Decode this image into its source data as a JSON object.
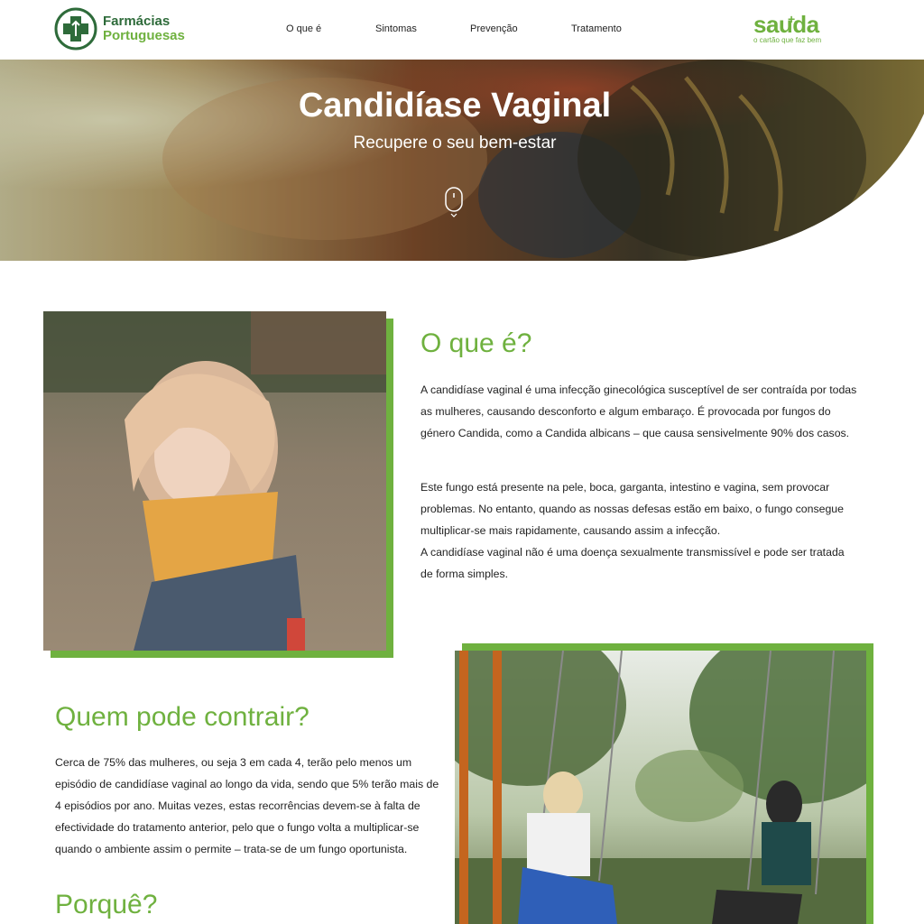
{
  "header": {
    "brand_line1": "Farmácias",
    "brand_line2": "Portuguesas",
    "nav": [
      {
        "label": "O que é"
      },
      {
        "label": "Sintomas"
      },
      {
        "label": "Prevenção"
      },
      {
        "label": "Tratamento"
      }
    ],
    "partner_word": "sauda",
    "partner_tagline": "o cartão que faz bem"
  },
  "hero": {
    "title": "Candidíase Vaginal",
    "subtitle": "Recupere o seu bem-estar"
  },
  "section_what": {
    "title": "O que é?",
    "p1": "A candidíase vaginal é uma infecção ginecológica susceptível de ser contraída por todas as mulheres, causando desconforto e algum embaraço. É provocada por fungos do género Candida, como a Candida albicans – que causa sensivelmente 90% dos casos.",
    "p2a": "Este fungo está presente na pele, boca, garganta, intestino e vagina, sem provocar problemas. No entanto, quando as nossas defesas estão em baixo, o fungo consegue multiplicar-se mais rapidamente, causando assim a infecção.",
    "p2b": "A candidíase vaginal não é uma doença sexualmente transmissível e pode ser tratada de forma simples."
  },
  "section_who": {
    "title": "Quem pode contrair?",
    "p1": "Cerca de 75% das mulheres, ou seja 3 em cada 4, terão pelo menos um episódio de candidíase vaginal ao longo da vida, sendo que 5% terão mais de 4 episódios por ano. Muitas vezes, estas recorrências devem-se à falta de efectividade do tratamento anterior, pelo que o fungo volta a multiplicar-se quando o ambiente assim o permite – trata-se de um fungo oportunista."
  },
  "section_why": {
    "title": "Porquê?"
  },
  "colors": {
    "brand_green": "#6fb13f",
    "brand_dark_green": "#2e6b3a"
  }
}
